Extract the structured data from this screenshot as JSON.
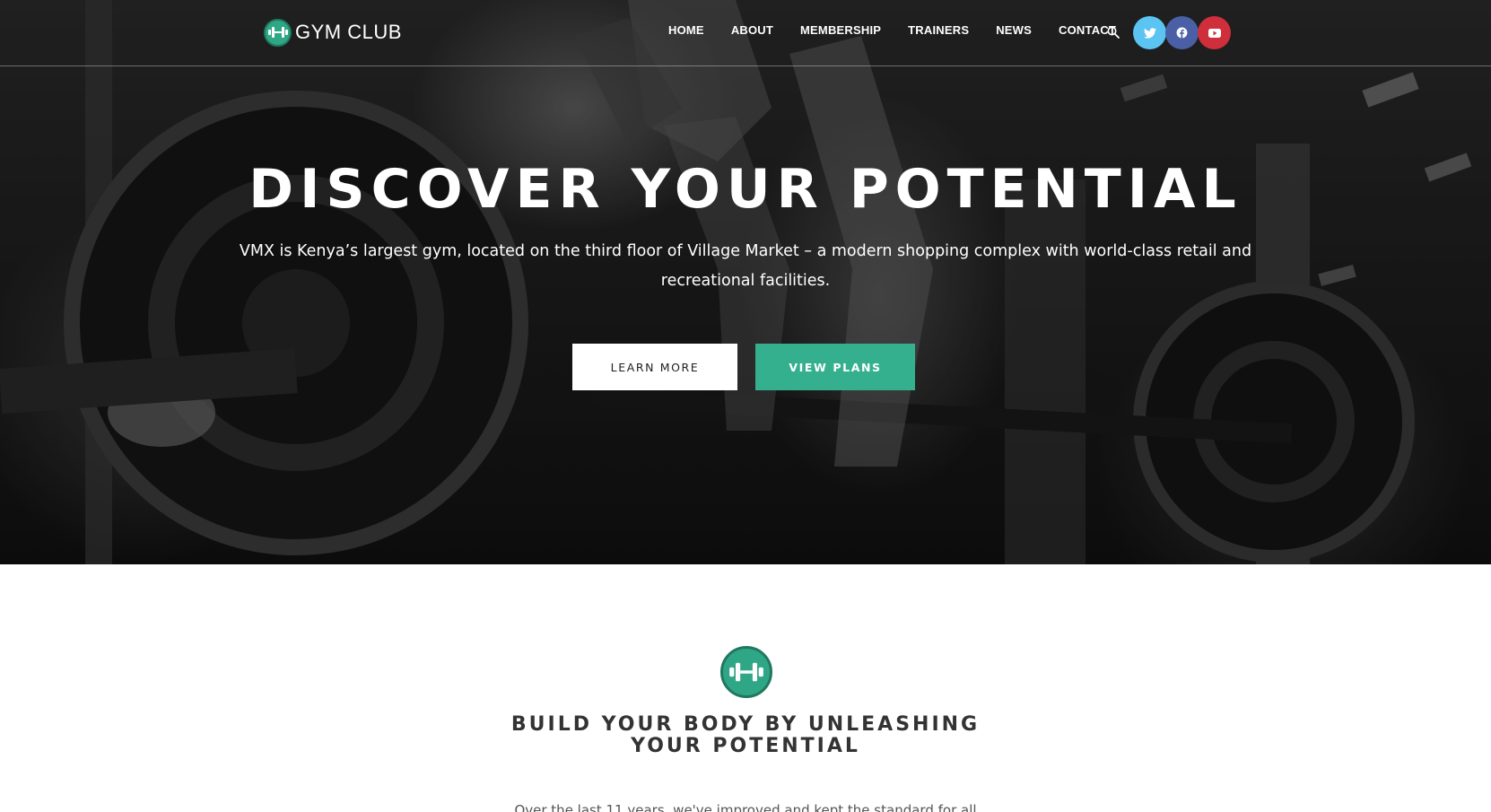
{
  "brand": {
    "name": "GYM CLUB",
    "logo_icon": "dumbbell-icon",
    "accent": "#35b08e"
  },
  "nav": {
    "items": [
      {
        "label": "HOME"
      },
      {
        "label": "ABOUT"
      },
      {
        "label": "MEMBERSHIP"
      },
      {
        "label": "TRAINERS"
      },
      {
        "label": "NEWS"
      },
      {
        "label": "CONTACT"
      }
    ],
    "search_icon": "search-icon"
  },
  "socials": [
    {
      "name": "twitter-icon",
      "color": "#5bc4f2"
    },
    {
      "name": "facebook-icon",
      "color": "#4a5fa6"
    },
    {
      "name": "youtube-icon",
      "color": "#cf2e3b"
    }
  ],
  "hero": {
    "title": "DISCOVER YOUR POTENTIAL",
    "subtitle": "VMX is Kenya’s largest gym, located on the third floor of Village Market – a modern shopping complex with world-class retail and recreational facilities.",
    "learn_more_label": "LEARN MORE",
    "view_plans_label": "VIEW PLANS"
  },
  "section": {
    "icon": "dumbbell-icon",
    "title": "BUILD YOUR BODY BY UNLEASHING YOUR POTENTIAL",
    "text_peek": "Over the last 11 years, we've improved and kept the standard for all"
  }
}
